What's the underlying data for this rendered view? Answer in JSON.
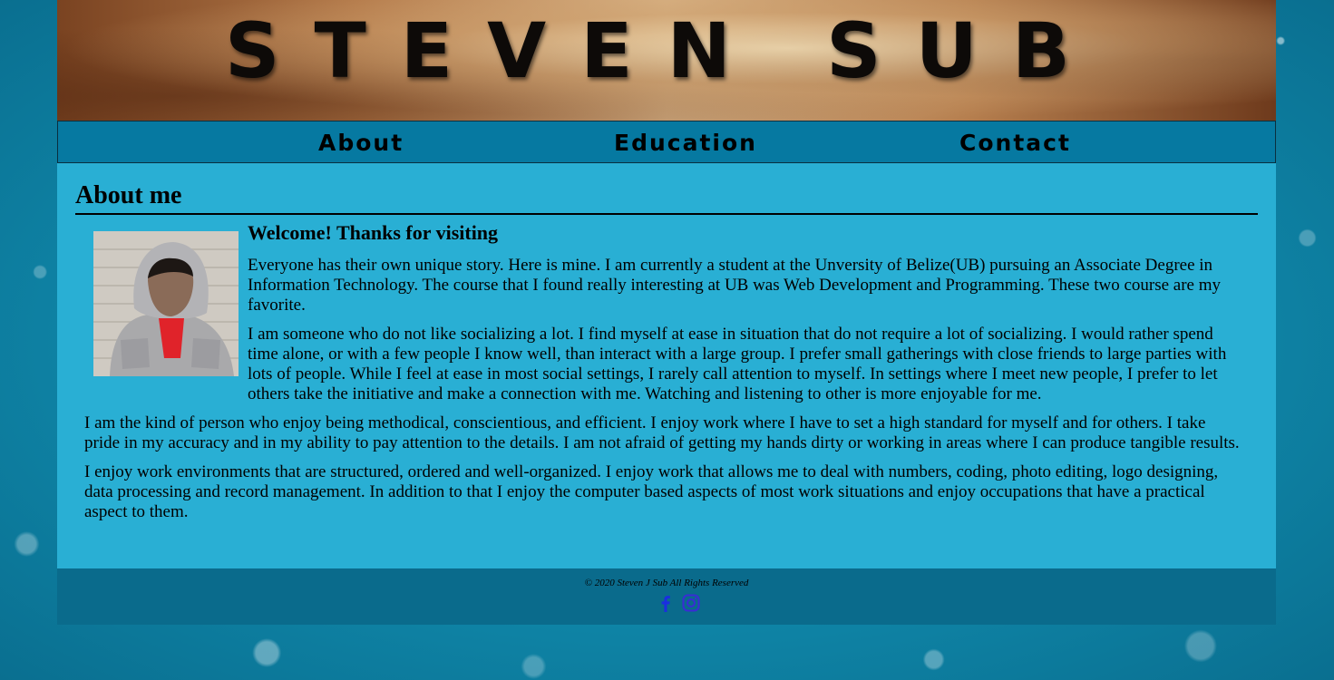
{
  "header": {
    "site_title": "STEVEN SUB"
  },
  "nav": {
    "items": [
      {
        "label": "About"
      },
      {
        "label": "Education"
      },
      {
        "label": "Contact"
      }
    ]
  },
  "main": {
    "section_title": "About me",
    "welcome_heading": "Welcome! Thanks for visiting",
    "paragraphs": [
      "Everyone has their own unique story. Here is mine. I am currently a student at the Unversity of Belize(UB) pursuing an Associate Degree in Information Technology. The course that I found really interesting at UB was Web Development and Programming. These two course are my favorite.",
      "I am someone who do not like socializing a lot. I find myself at ease in situation that do not require a lot of socializing. I would rather spend time alone, or with a few people I know well, than interact with a large group. I prefer small gatherings with close friends to large parties with lots of people. While I feel at ease in most social settings, I rarely call attention to myself. In settings where I meet new people, I prefer to let others take the initiative and make a connection with me. Watching and listening to other is more enjoyable for me.",
      "I am the kind of person who enjoy being methodical, conscientious, and efficient. I enjoy work where I have to set a high standard for myself and for others. I take pride in my accuracy and in my ability to pay attention to the details. I am not afraid of getting my hands dirty or working in areas where I can produce tangible results.",
      "I enjoy work environments that are structured, ordered and well-organized. I enjoy work that allows me to deal with numbers, coding, photo editing, logo designing, data processing and record management. In addition to that I enjoy the computer based aspects of most work situations and enjoy occupations that have a practical aspect to them."
    ]
  },
  "footer": {
    "copyright": "© 2020 Steven J Sub All Rights Reserved",
    "social": [
      {
        "icon": "facebook-icon",
        "color": "#1a2ee0"
      },
      {
        "icon": "instagram-icon",
        "color": "#3a2bd6"
      }
    ]
  },
  "colors": {
    "page_background": "#29afd4",
    "nav_background": "#0679a1",
    "footer_background": "#0a6b8c"
  }
}
